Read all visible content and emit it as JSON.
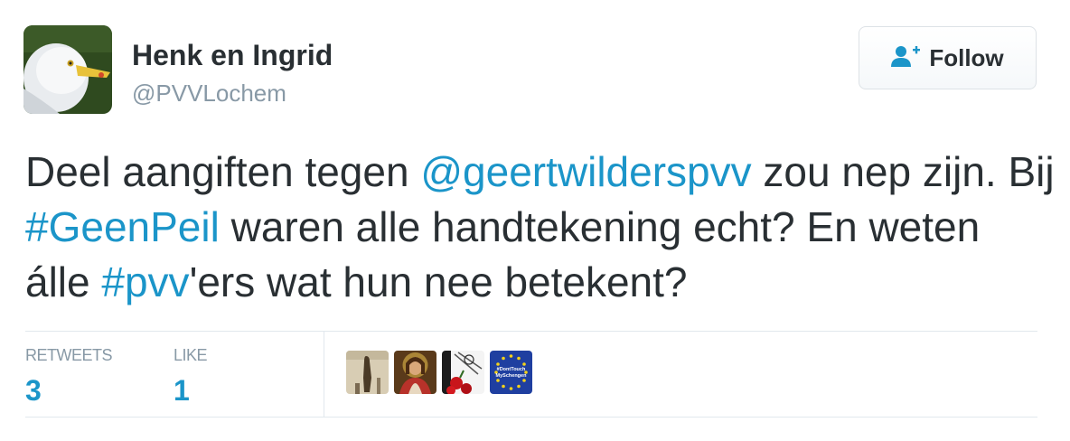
{
  "user": {
    "display_name": "Henk en Ingrid",
    "handle": "@PVVLochem"
  },
  "follow_button": {
    "label": "Follow",
    "icon": "add-user-icon"
  },
  "tweet": {
    "text_parts": {
      "p1": "Deel aangiften tegen ",
      "mention": "@geertwilderspvv",
      "p2": " zou nep zijn. Bij ",
      "hashtag1": "#GeenPeil",
      "p3": " waren alle handtekening echt? En weten álle ",
      "hashtag2": "#pvv",
      "p4": "'ers wat hun nee betekent?"
    }
  },
  "stats": {
    "retweets_label": "RETWEETS",
    "retweets_count": "3",
    "likes_label": "LIKE",
    "likes_count": "1"
  },
  "liker_avatars": [
    {
      "name": "statue-avatar"
    },
    {
      "name": "portrait-avatar"
    },
    {
      "name": "rose-avatar"
    },
    {
      "name": "eu-flag-avatar",
      "text_line1": "#DontTouch",
      "text_line2": "MySchengen"
    }
  ],
  "colors": {
    "link": "#1b95c9",
    "text": "#292f33",
    "secondary": "#8899a6",
    "border": "#e1e8ed"
  }
}
